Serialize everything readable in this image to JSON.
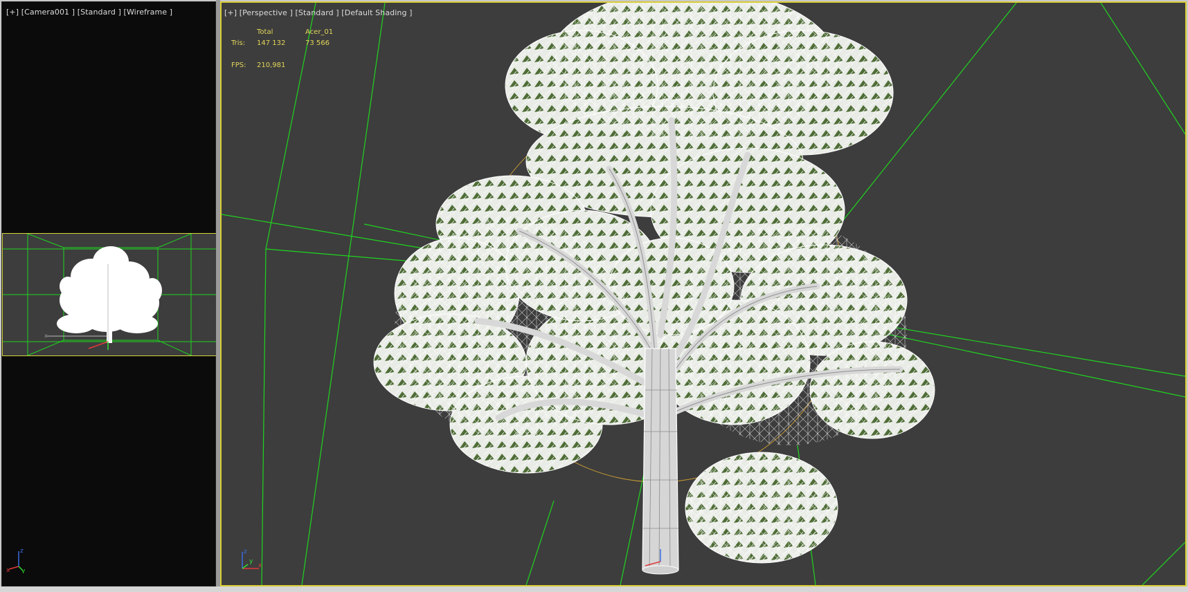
{
  "left_viewport": {
    "label": "[+] [Camera001 ] [Standard ] [Wireframe ]",
    "gizmo": {
      "x": "x",
      "y": "y",
      "z": "z"
    }
  },
  "main_viewport": {
    "label": "[+] [Perspective ] [Standard ] [Default Shading ]",
    "stats": {
      "col_total": "Total",
      "col_object": "Acer_01",
      "tris_label": "Tris:",
      "tris_total": "147 132",
      "tris_object": "73 566",
      "fps_label": "FPS:",
      "fps_value": "210,981"
    },
    "gizmo": {
      "x": "x",
      "y": "y",
      "z": "z"
    }
  },
  "colors": {
    "viewport_bg": "#3d3d3d",
    "active_border": "#d9cd36",
    "stats_text": "#e3d65a",
    "grid_lines": "#1fd51f",
    "camera_bg": "#0b0b0b"
  }
}
